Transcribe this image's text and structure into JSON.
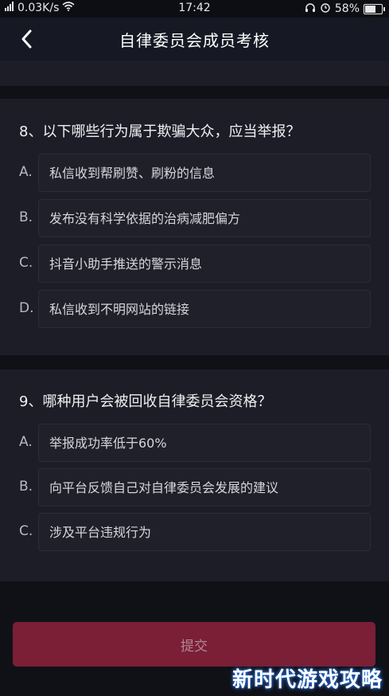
{
  "status_bar": {
    "network_speed": "0.03K/s",
    "time": "17:42",
    "battery": "58%"
  },
  "header": {
    "title": "自律委员会成员考核"
  },
  "questions": [
    {
      "question": "8、以下哪些行为属于欺骗大众，应当举报？",
      "options": [
        {
          "letter": "A.",
          "text": "私信收到帮刷赞、刷粉的信息"
        },
        {
          "letter": "B.",
          "text": "发布没有科学依据的治病减肥偏方"
        },
        {
          "letter": "C.",
          "text": "抖音小助手推送的警示消息"
        },
        {
          "letter": "D.",
          "text": "私信收到不明网站的链接"
        }
      ]
    },
    {
      "question": "9、哪种用户会被回收自律委员会资格？",
      "options": [
        {
          "letter": "A.",
          "text": "举报成功率低于60%"
        },
        {
          "letter": "B.",
          "text": "向平台反馈自己对自律委员会发展的建议"
        },
        {
          "letter": "C.",
          "text": "涉及平台违规行为"
        }
      ]
    }
  ],
  "submit": {
    "label": "提交"
  },
  "watermark": "新时代游戏攻略",
  "colors": {
    "background": "#161823",
    "submit": "#7a1f35"
  }
}
